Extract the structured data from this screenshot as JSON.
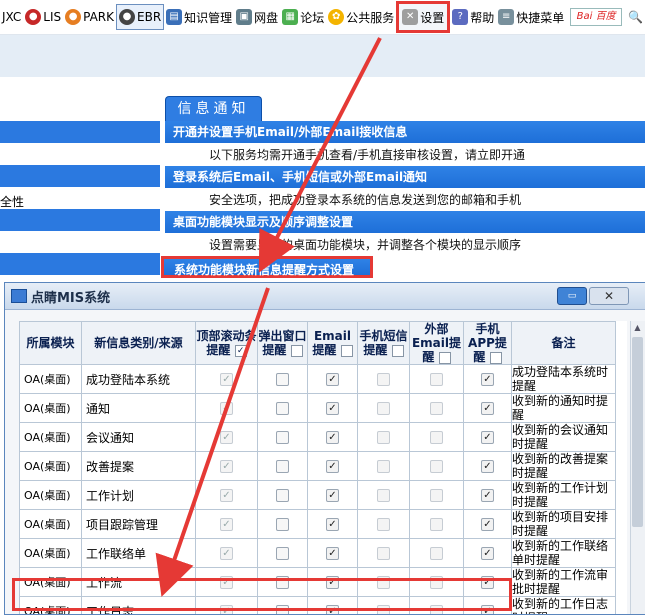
{
  "toolbar": {
    "items": [
      {
        "label": "JXC",
        "icon": "jxc-icon"
      },
      {
        "label": "LIS",
        "icon": "lis-icon"
      },
      {
        "label": "PARK",
        "icon": "park-icon"
      },
      {
        "label": "EBR",
        "icon": "ebr-icon"
      },
      {
        "label": "知识管理",
        "icon": "knowledge-icon"
      },
      {
        "label": "网盘",
        "icon": "netdisk-icon"
      },
      {
        "label": "论坛",
        "icon": "forum-icon"
      },
      {
        "label": "公共服务",
        "icon": "public-service-icon"
      },
      {
        "label": "设置",
        "icon": "settings-icon"
      },
      {
        "label": "帮助",
        "icon": "help-icon"
      },
      {
        "label": "快捷菜单",
        "icon": "shortcut-menu-icon"
      }
    ],
    "search_logo": "Bai 百度"
  },
  "left_panel": {
    "partial_text": "全性"
  },
  "notice": {
    "tab_label": "信息通知",
    "sections": [
      {
        "heading": "开通并设置手机Email/外部Email接收信息",
        "desc": "以下服务均需开通手机查看/手机直接审核设置，请立即开通"
      },
      {
        "heading": "登录系统后Email、手机短信或外部Email通知",
        "desc": "安全选项，把成功登录本系统的信息发送到您的邮箱和手机"
      },
      {
        "heading": "桌面功能模块显示及顺序调整设置",
        "desc": "设置需要显示的桌面功能模块，并调整各个模块的显示顺序"
      },
      {
        "heading": "系统功能模块新信息提醒方式设置",
        "desc": ""
      }
    ]
  },
  "dialog": {
    "title": "点睛MIS系统",
    "columns": [
      {
        "label": "所属模块",
        "checkbox": false
      },
      {
        "label": "新信息类别/来源",
        "checkbox": false
      },
      {
        "label": "顶部滚动条提醒",
        "checkbox": true,
        "header_checked": true
      },
      {
        "label": "弹出窗口提醒",
        "checkbox": true,
        "header_checked": false
      },
      {
        "label": "Email提醒",
        "checkbox": true,
        "header_checked": false
      },
      {
        "label": "手机短信提醒",
        "checkbox": true,
        "header_checked": false
      },
      {
        "label": "外部Email提醒",
        "checkbox": true,
        "header_checked": false
      },
      {
        "label": "手机APP提醒",
        "checkbox": true,
        "header_checked": false
      },
      {
        "label": "备注",
        "checkbox": false
      }
    ],
    "rows": [
      {
        "module": "OA(桌面)",
        "type": "成功登陆本系统",
        "checks": [
          true,
          false,
          true,
          false,
          false,
          true
        ],
        "note": "成功登陆本系统时提醒"
      },
      {
        "module": "OA(桌面)",
        "type": "通知",
        "checks": [
          true,
          false,
          true,
          false,
          false,
          true
        ],
        "note": "收到新的通知时提醒"
      },
      {
        "module": "OA(桌面)",
        "type": "会议通知",
        "checks": [
          true,
          false,
          true,
          false,
          false,
          true
        ],
        "note": "收到新的会议通知时提醒"
      },
      {
        "module": "OA(桌面)",
        "type": "改善提案",
        "checks": [
          true,
          false,
          true,
          false,
          false,
          true
        ],
        "note": "收到新的改善提案时提醒"
      },
      {
        "module": "OA(桌面)",
        "type": "工作计划",
        "checks": [
          true,
          false,
          true,
          false,
          false,
          true
        ],
        "note": "收到新的工作计划时提醒"
      },
      {
        "module": "OA(桌面)",
        "type": "项目跟踪管理",
        "checks": [
          true,
          false,
          true,
          false,
          false,
          true
        ],
        "note": "收到新的项目安排时提醒"
      },
      {
        "module": "OA(桌面)",
        "type": "工作联络单",
        "checks": [
          true,
          false,
          true,
          false,
          false,
          true
        ],
        "note": "收到新的工作联络单时提醒"
      },
      {
        "module": "OA(桌面)",
        "type": "工作流",
        "checks": [
          true,
          false,
          true,
          false,
          false,
          true
        ],
        "note": "收到新的工作流审批时提醒"
      },
      {
        "module": "OA(桌面)",
        "type": "工作日志",
        "checks": [
          true,
          false,
          true,
          false,
          false,
          true
        ],
        "note": "收到新的工作日志时提醒"
      }
    ]
  },
  "colors": {
    "highlight": "#e53935",
    "accent": "#2b79e0"
  }
}
